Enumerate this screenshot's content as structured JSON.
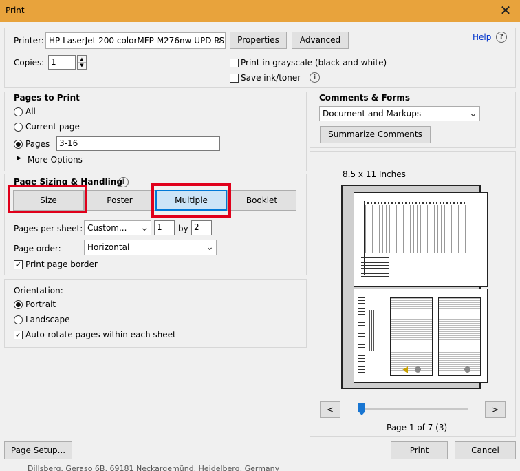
{
  "window": {
    "title": "Print",
    "close_glyph": "✕"
  },
  "printer": {
    "label": "Printer:",
    "selected": "HP LaserJet 200 colorMFP M276nw UPD PS",
    "properties_label": "Properties",
    "advanced_label": "Advanced",
    "help_label": "Help",
    "help_glyph": "?"
  },
  "copies": {
    "label": "Copies:",
    "value": "1"
  },
  "options": {
    "grayscale_label": "Print in grayscale (black and white)",
    "grayscale_checked": false,
    "save_ink_label": "Save ink/toner",
    "save_ink_checked": false,
    "info_glyph": "i"
  },
  "pages_to_print": {
    "header": "Pages to Print",
    "all_label": "All",
    "current_label": "Current page",
    "pages_label": "Pages",
    "pages_value": "3-16",
    "selected": "Pages",
    "more_options_label": "More Options",
    "expand_glyph": "▶"
  },
  "page_sizing": {
    "header": "Page Sizing & Handling",
    "tabs": [
      "Size",
      "Poster",
      "Multiple",
      "Booklet"
    ],
    "active_tab": "Multiple",
    "pages_per_sheet_label": "Pages per sheet:",
    "pages_per_sheet_value": "Custom...",
    "cols_value": "1",
    "by_label": "by",
    "rows_value": "2",
    "page_order_label": "Page order:",
    "page_order_value": "Horizontal",
    "print_border_label": "Print page border",
    "print_border_checked": true
  },
  "orientation": {
    "header": "Orientation:",
    "portrait_label": "Portrait",
    "landscape_label": "Landscape",
    "selected": "Portrait",
    "auto_rotate_label": "Auto-rotate pages within each sheet",
    "auto_rotate_checked": true
  },
  "comments_forms": {
    "header": "Comments & Forms",
    "selected": "Document and Markups",
    "summarize_label": "Summarize Comments"
  },
  "preview": {
    "size_label": "8.5 x 11 Inches",
    "prev_glyph": "<",
    "next_glyph": ">",
    "page_status": "Page 1 of 7 (3)",
    "slider_position": 0
  },
  "footer": {
    "page_setup_label": "Page Setup...",
    "print_label": "Print",
    "cancel_label": "Cancel",
    "background_text": "Dillsberg. Geraso 6B, 69181 Neckargemünd, Heidelberg, Germany"
  }
}
